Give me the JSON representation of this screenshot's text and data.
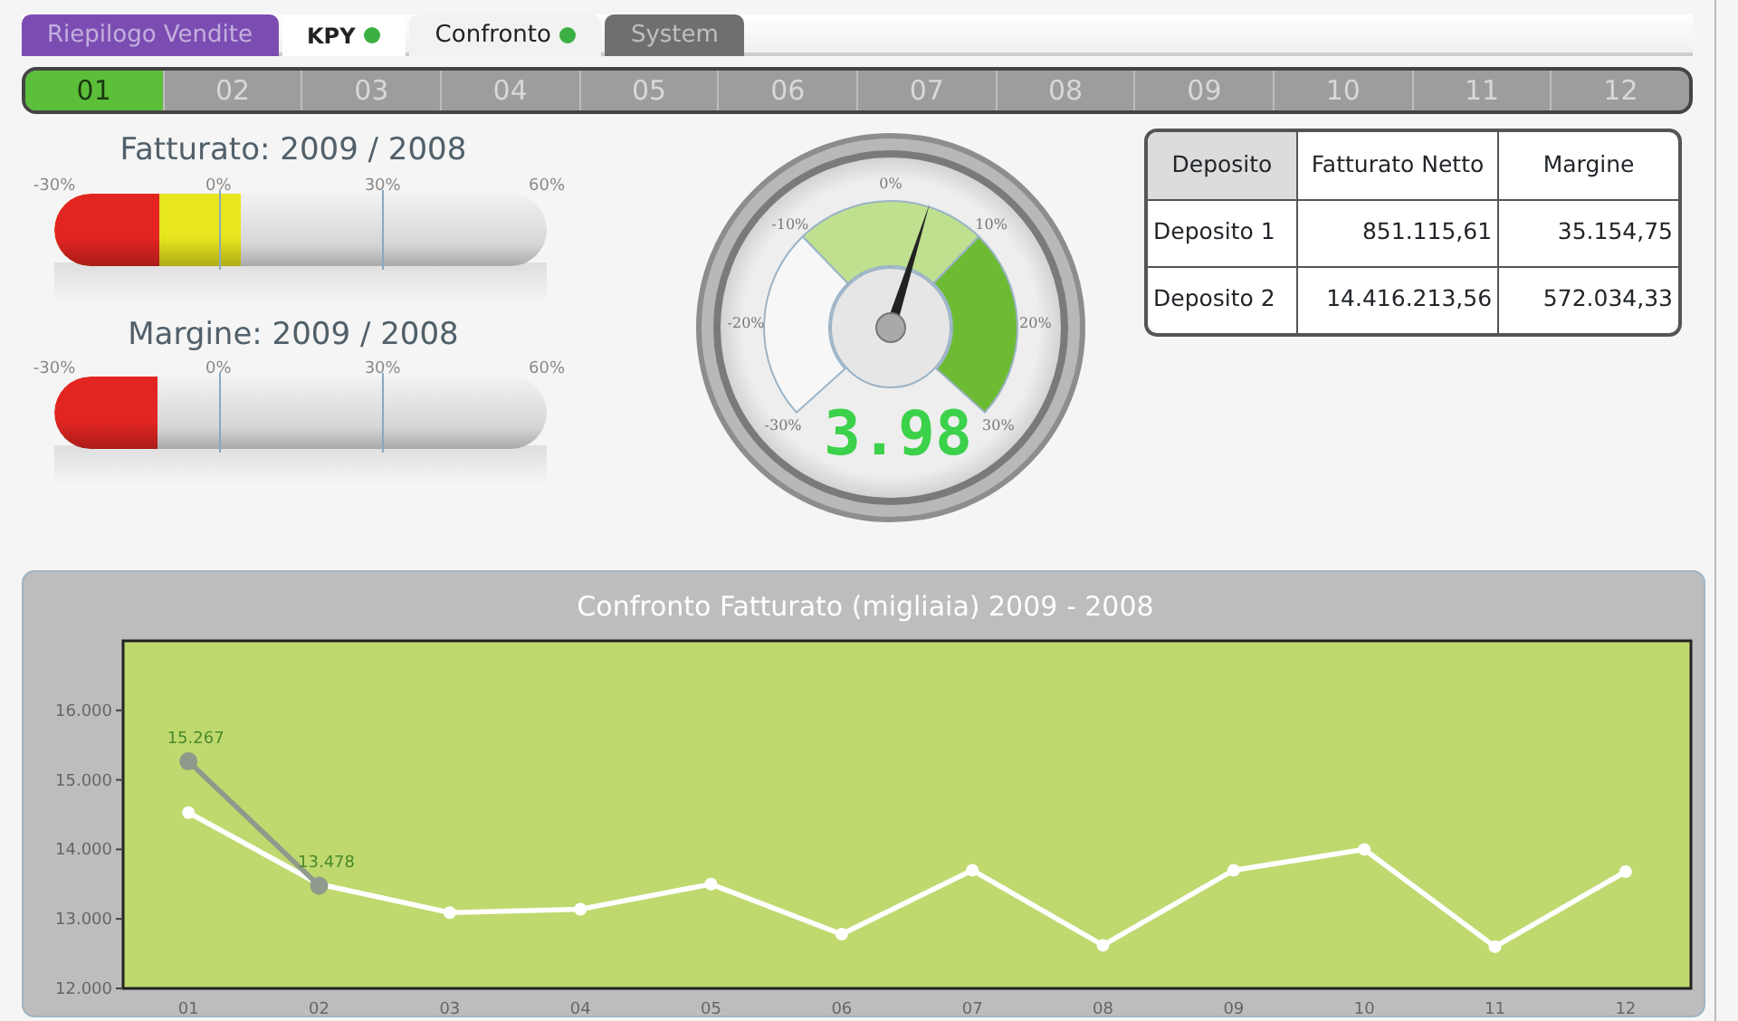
{
  "tabs": [
    {
      "label": "Riepilogo Vendite",
      "selected": false,
      "color": "#7b4db3",
      "dot": false
    },
    {
      "label": "KPY",
      "selected": true,
      "color": "#ffffff",
      "dot": true
    },
    {
      "label": "Confronto",
      "selected": false,
      "color": "#f2f2f2",
      "dot": true
    },
    {
      "label": "System",
      "selected": false,
      "color": "#6f6f6f",
      "dot": false
    }
  ],
  "months": [
    {
      "label": "01",
      "selected": true
    },
    {
      "label": "02",
      "selected": false
    },
    {
      "label": "03",
      "selected": false
    },
    {
      "label": "04",
      "selected": false
    },
    {
      "label": "05",
      "selected": false
    },
    {
      "label": "06",
      "selected": false
    },
    {
      "label": "07",
      "selected": false
    },
    {
      "label": "08",
      "selected": false
    },
    {
      "label": "09",
      "selected": false
    },
    {
      "label": "10",
      "selected": false
    },
    {
      "label": "11",
      "selected": false
    },
    {
      "label": "12",
      "selected": false
    }
  ],
  "bars": [
    {
      "title": "Fatturato: 2009 / 2008",
      "ticks": [
        "-30%",
        "0%",
        "30%",
        "60%"
      ],
      "segments": [
        {
          "color": "#e32522",
          "level": 0.215
        },
        {
          "color": "#e8e61e",
          "level": 0.38
        }
      ]
    },
    {
      "title": "Margine: 2009 / 2008",
      "ticks": [
        "-30%",
        "0%",
        "30%",
        "60%"
      ],
      "segments": [
        {
          "color": "#e32522",
          "level": 0.21
        }
      ]
    }
  ],
  "gauge": {
    "labels": [
      "-30%",
      "-20%",
      "-10%",
      "0%",
      "10%",
      "20%",
      "30%"
    ],
    "level": 0.566,
    "reading": "3.98"
  },
  "table": {
    "columns": [
      "Deposito",
      "Fatturato Netto",
      "Margine"
    ],
    "rows": [
      [
        "Deposito 1",
        "851.115,61",
        "35.154,75"
      ],
      [
        "Deposito 2",
        "14.416.213,56",
        "572.034,33"
      ]
    ]
  },
  "chart": {
    "chart_data": {
      "type": "line",
      "title": "Confronto Fatturato (migliaia) 2009 - 2008",
      "categories": [
        "01",
        "02",
        "03",
        "04",
        "05",
        "06",
        "07",
        "08",
        "09",
        "10",
        "11",
        "12"
      ],
      "series": [
        {
          "color": "#ffffff",
          "marker": "circle",
          "values": [
            14530,
            13500,
            13090,
            13140,
            13500,
            12780,
            13700,
            12620,
            13700,
            14000,
            12600,
            13680
          ]
        },
        {
          "color": "#8f9a8c",
          "marker": "circle",
          "values": [
            15267,
            13478,
            null,
            null,
            null,
            null,
            null,
            null,
            null,
            null,
            null,
            null
          ]
        }
      ],
      "ylim": [
        12000,
        17000
      ],
      "yticks": [
        {
          "value": 12000,
          "label": "12.000"
        },
        {
          "value": 13000,
          "label": "13.000"
        },
        {
          "value": 14000,
          "label": "14.000"
        },
        {
          "value": 15000,
          "label": "15.000"
        },
        {
          "value": 16000,
          "label": "16.000"
        }
      ],
      "annotations": [
        {
          "x": "01",
          "y": 15267,
          "text": "15.267"
        },
        {
          "x": "02",
          "y": 13478,
          "text": "13.478"
        }
      ]
    }
  }
}
